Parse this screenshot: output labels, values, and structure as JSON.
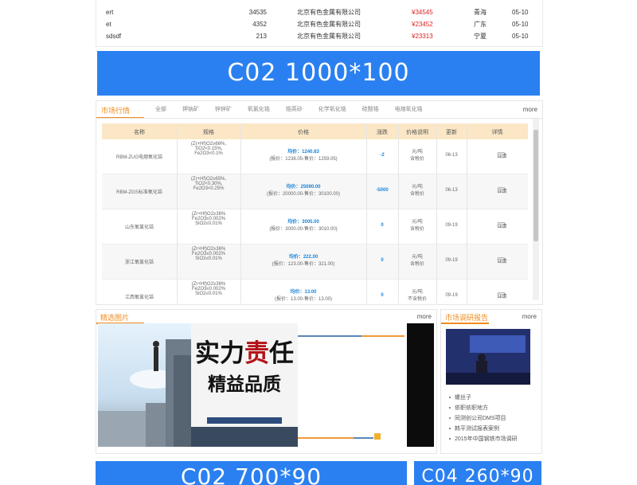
{
  "top_table": {
    "rows": [
      {
        "name": "",
        "qty": "",
        "company": "",
        "price": "",
        "province": "",
        "date": ""
      },
      {
        "name": "ert",
        "qty": "34535",
        "company": "北京有色金属有限公司",
        "price": "¥34545",
        "province": "青海",
        "date": "05-10"
      },
      {
        "name": "et",
        "qty": "4352",
        "company": "北京有色金属有限公司",
        "price": "¥23452",
        "province": "广东",
        "date": "05-10"
      },
      {
        "name": "sdsdf",
        "qty": "213",
        "company": "北京有色金属有限公司",
        "price": "¥23313",
        "province": "宁夏",
        "date": "05-10"
      }
    ]
  },
  "banner_top": "C02  1000*100",
  "market": {
    "title": "市场行情",
    "more": "more",
    "tabs": [
      "全部",
      "钾钠矿",
      "锌锌矿",
      "氧氯化锆",
      "锆英砂",
      "化学氧化锆",
      "硅酸锆",
      "电熔氧化锆"
    ],
    "headers": [
      "名称",
      "规格",
      "价格",
      "涨跌",
      "价格说明",
      "更新",
      "详情"
    ],
    "rows": [
      {
        "name": "RBM-ZUG电熔氧化锆",
        "spec": [
          "(Zr+Hf)O2≥66%,",
          "TiO2<0.15%,",
          "Fe2O3<0.1%"
        ],
        "price": "均价：1240.83",
        "range": "(报价：1238.05-售价：1259.05)",
        "change": "-2",
        "unit": [
          "元/吨",
          "含税价"
        ],
        "updated": "06-13",
        "detail": "详情"
      },
      {
        "name": "RBM-ZGS标准氧化锆",
        "spec": [
          "(Zr+Hf)O2≥65%,",
          "TiO2<0.30%,",
          "Fe2O3<0.25%"
        ],
        "price": "均价：25090.00",
        "range": "(报价：20000.00-售价：30100.00)",
        "change": "-5000",
        "unit": [
          "元/吨",
          "含税价"
        ],
        "updated": "06-13",
        "detail": "详情"
      },
      {
        "name": "山东氧氯化锆",
        "spec": [
          "(Zr+Hf)O2≥36%",
          "Fe2O3≤0.002%",
          "SiO2≤0.01%"
        ],
        "price": "均价：3005.00",
        "range": "(报价：3000.00-售价：3010.00)",
        "change": "0",
        "unit": [
          "元/吨",
          "含税价"
        ],
        "updated": "09-19",
        "detail": "详情"
      },
      {
        "name": "浙江氧氯化锆",
        "spec": [
          "(Zr+Hf)O2≥36%",
          "Fe2O3≤0.002%",
          "SiO2≤0.01%"
        ],
        "price": "均价：222.00",
        "range": "(报价：123.00-售价：321.00)",
        "change": "0",
        "unit": [
          "元/吨",
          "含税价"
        ],
        "updated": "09-19",
        "detail": "详情"
      },
      {
        "name": "江西氧氯化锆",
        "spec": [
          "(Zr+Hf)O2≥36%",
          "Fe2O3≤0.002%",
          "SiO2≤0.01%"
        ],
        "price": "均价：13.00",
        "range": "(报价：13.00-售价：13.00)",
        "change": "0",
        "unit": [
          "元/吨",
          "不含税价"
        ],
        "updated": "09-19",
        "detail": "详情"
      }
    ]
  },
  "pics": {
    "title": "精选图片",
    "more": "more",
    "slogan_line1": [
      "实",
      "力",
      "责",
      "任"
    ],
    "slogan_line2": "精益品质",
    "slogan_big": "质"
  },
  "reports": {
    "title": "市场调研报告",
    "more": "more",
    "items": [
      "螺丝子",
      "依职依职地方",
      "同测创公司DMS项目",
      "韩平测试报表案例",
      "2015年中国钢铁市场调研"
    ]
  },
  "banner_bottom_left": "C02  700*90",
  "banner_bottom_right": "C04 260*90",
  "colors": {
    "accent": "#2a80f1",
    "orange": "#f08c1e",
    "price_red": "#e02020",
    "link_blue": "#1a84d8"
  }
}
